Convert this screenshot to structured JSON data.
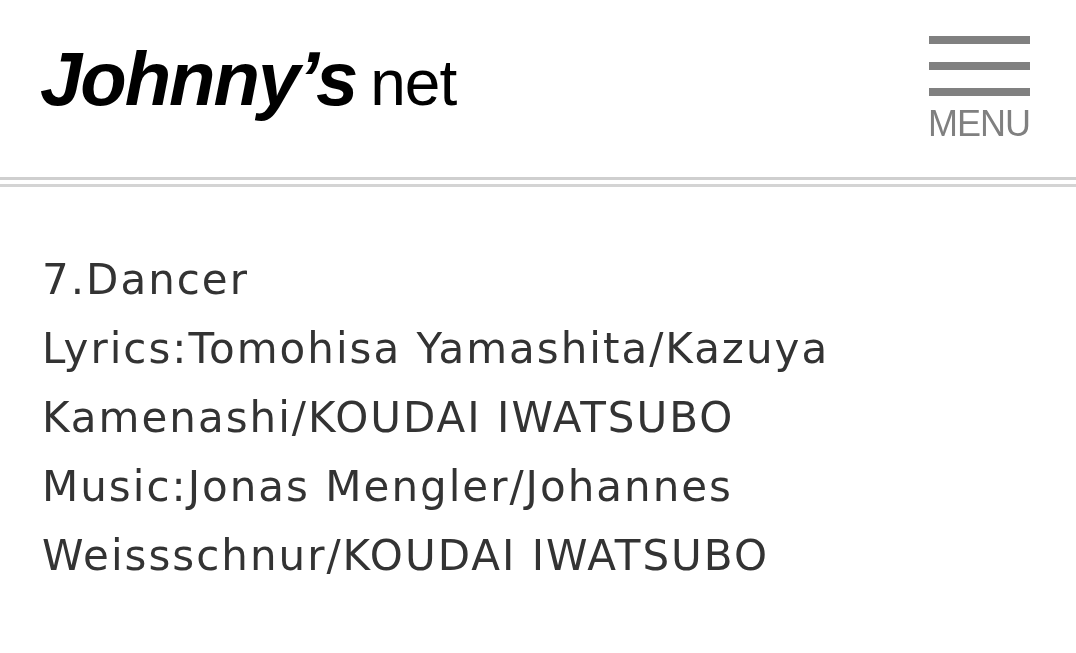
{
  "header": {
    "logo": {
      "brand": "Johnny’s",
      "suffix": "net"
    },
    "menu_button": {
      "label": "MENU"
    }
  },
  "track": {
    "title": "7.Dancer",
    "credits": [
      "Lyrics:Tomohisa Yamashita/Kazuya Kamenashi/KOUDAI IWATSUBO",
      "Music:Jonas Mengler/Johannes Weissschnur/KOUDAI IWATSUBO"
    ]
  }
}
